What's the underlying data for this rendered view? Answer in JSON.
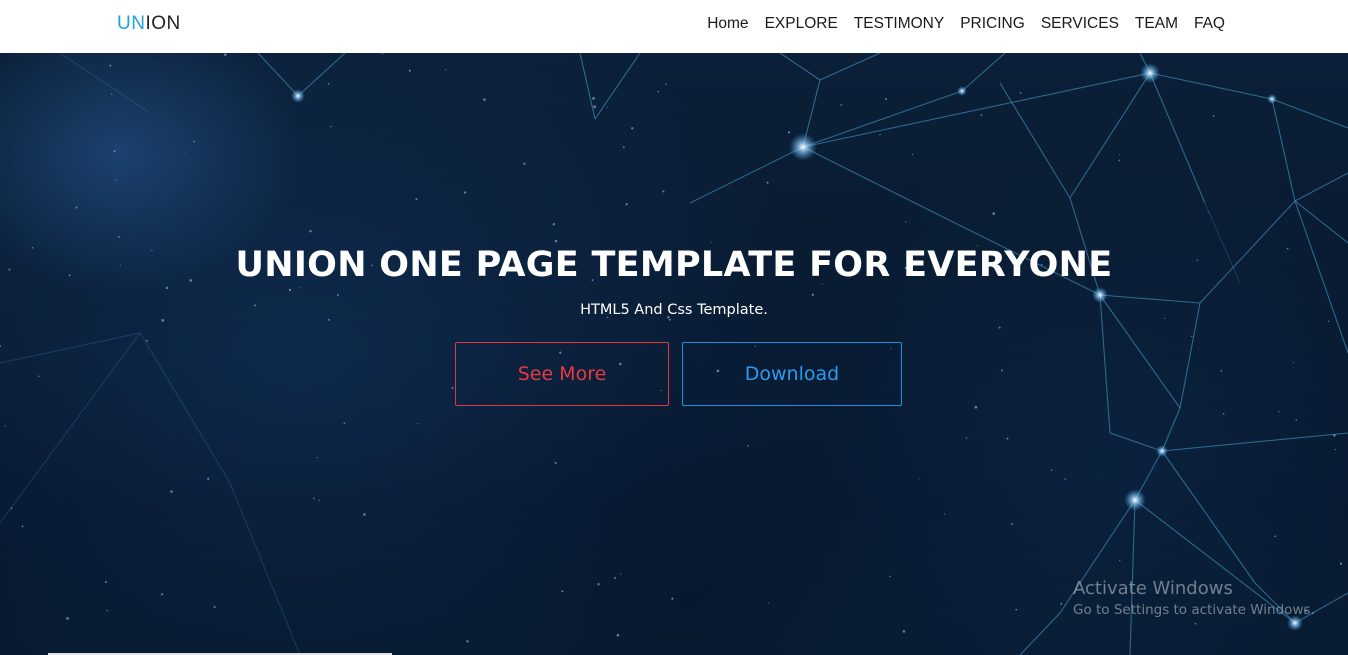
{
  "brand": {
    "part1": "UN",
    "part2": "ION"
  },
  "nav": {
    "items": [
      "Home",
      "EXPLORE",
      "TESTIMONY",
      "PRICING",
      "SERVICES",
      "TEAM",
      "FAQ"
    ]
  },
  "hero": {
    "title": "UNION ONE PAGE TEMPLATE FOR EVERYONE",
    "subtitle": "HTML5 And Css Template.",
    "see_more_label": "See More",
    "download_label": "Download"
  },
  "watermark": {
    "title": "Activate Windows",
    "subtitle": "Go to Settings to activate Windows."
  },
  "colors": {
    "brand_accent": "#1fa3d9",
    "see_more": "#ea3940",
    "download": "#2a9cf0",
    "hero_bg": "#081a30"
  }
}
